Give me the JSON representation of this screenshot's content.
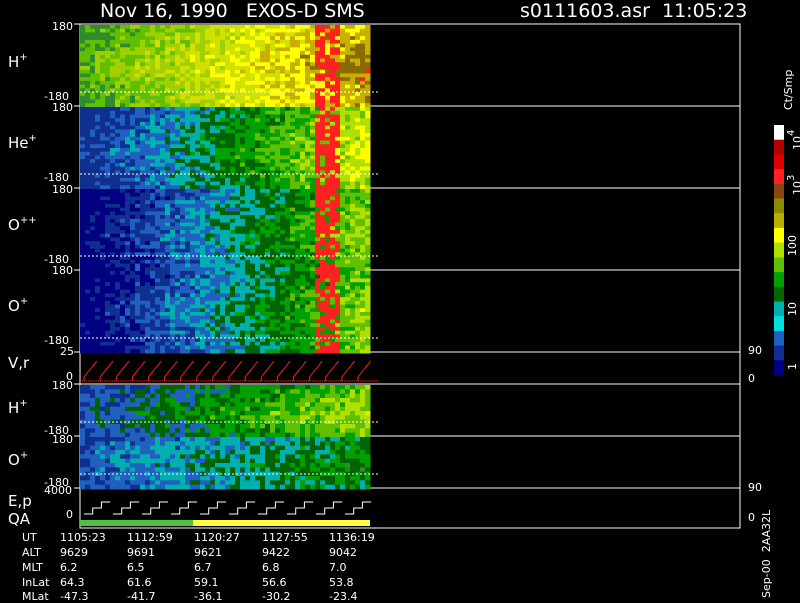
{
  "header": {
    "title": "Nov 16, 1990   EXOS-D SMS",
    "file_time": "s0111603.asr  11:05:23"
  },
  "colors": {
    "background": "#000000",
    "frame": "#ffffff",
    "trace": "#ff2020"
  },
  "rows": [
    {
      "id": "h_plus",
      "label": "H",
      "sup": "+",
      "ymax": "180",
      "ymin": "-180"
    },
    {
      "id": "he_plus",
      "label": "He",
      "sup": "+",
      "ymax": "180",
      "ymin": "-180"
    },
    {
      "id": "o_pp",
      "label": "O",
      "sup": "++",
      "ymax": "180",
      "ymin": "-180"
    },
    {
      "id": "o_plus",
      "label": "O",
      "sup": "+",
      "ymax": "180",
      "ymin": "-180"
    },
    {
      "id": "vr",
      "label": "V,r",
      "sup": "",
      "ymax": "25",
      "ymin": "0",
      "right_max": "90",
      "right_min": "0"
    },
    {
      "id": "h_plus2",
      "label": "H",
      "sup": "+",
      "ymax": "180",
      "ymin": "-180"
    },
    {
      "id": "o_plus2",
      "label": "O",
      "sup": "+",
      "ymax": "180",
      "ymin": "-180"
    },
    {
      "id": "ep",
      "label": "E,p",
      "label2": "QA",
      "sup": "",
      "ymax": "4000",
      "ymin": "0",
      "right_max": "90",
      "right_min": "0"
    }
  ],
  "chart_data": {
    "type": "heatmap",
    "title": "Nov 16, 1990   EXOS-D SMS",
    "colorbar": {
      "label": "Ct/Smp",
      "ticks": [
        "10",
        "10",
        "10",
        "100",
        "10",
        "1"
      ],
      "tick_sup": [
        "4",
        "3",
        "",
        "",
        "",
        ""
      ],
      "colors": [
        "#ffffff",
        "#b00000",
        "#e00000",
        "#ff2020",
        "#8b4513",
        "#8b8b00",
        "#b8b000",
        "#ffff00",
        "#b0e000",
        "#60c000",
        "#00a000",
        "#006400",
        "#00b0b0",
        "#00e0e0",
        "#2060c0",
        "#103090",
        "#000080"
      ]
    },
    "x_time": [
      "1105:23",
      "1112:59",
      "1120:27",
      "1127:55",
      "1136:19"
    ],
    "orbit": {
      "UT": [
        "1105:23",
        "1112:59",
        "1120:27",
        "1127:55",
        "1136:19"
      ],
      "ALT": [
        "9629",
        "9691",
        "9621",
        "9422",
        "9042"
      ],
      "MLT": [
        "6.2",
        "6.5",
        "6.7",
        "6.8",
        "7.0"
      ],
      "InLat": [
        "64.3",
        "61.6",
        "59.1",
        "56.6",
        "53.8"
      ],
      "MLat": [
        "-47.3",
        "-41.7",
        "-36.1",
        "-30.2",
        "-23.4"
      ]
    },
    "qa_bar_colors": [
      "#50c040",
      "#ffff40"
    ]
  },
  "footer": {
    "id_text": "Sep-00  2AA32L"
  }
}
